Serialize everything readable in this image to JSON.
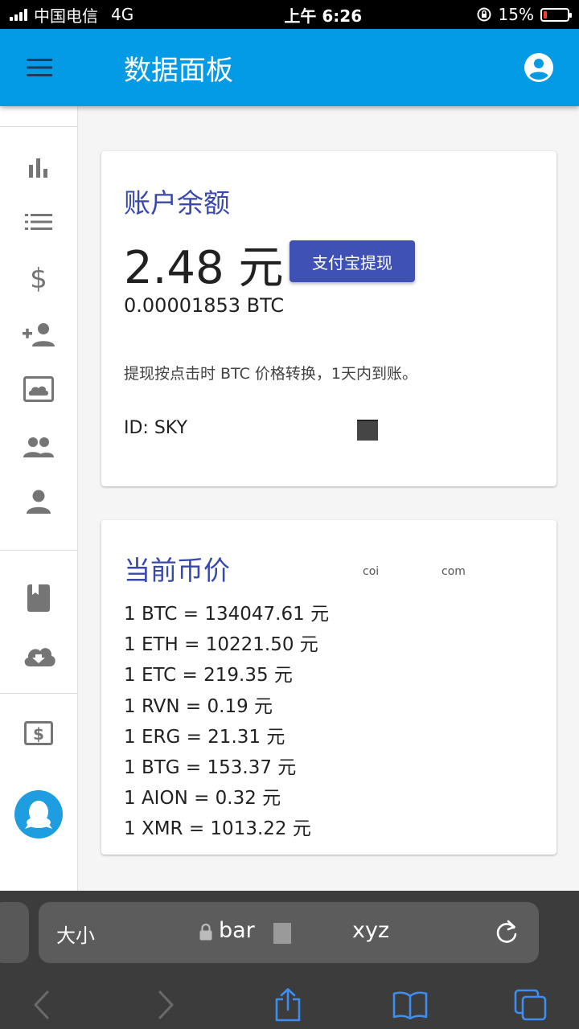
{
  "status_bar": {
    "carrier": "中国电信",
    "network": "4G",
    "time": "上午 6:26",
    "battery_percent": "15%"
  },
  "app_bar": {
    "title": "数据面板",
    "menu_icon": "menu-icon",
    "account_icon": "account-circle-icon",
    "color": "#039be5"
  },
  "drawer": {
    "items": [
      {
        "icon": "bar-chart-icon"
      },
      {
        "icon": "list-icon"
      },
      {
        "icon": "dollar-icon"
      },
      {
        "icon": "person-add-icon"
      },
      {
        "icon": "cloud-image-icon"
      },
      {
        "icon": "people-icon"
      },
      {
        "icon": "person-icon"
      },
      {
        "icon": "book-icon"
      },
      {
        "icon": "cloud-download-icon"
      },
      {
        "icon": "money-icon"
      },
      {
        "icon": "qq-icon"
      }
    ]
  },
  "balance_card": {
    "title": "账户余额",
    "amount_cny": "2.48 元",
    "withdraw_button": "支付宝提现",
    "amount_btc": "0.00001853 BTC",
    "note": "提现按点击时 BTC 价格转换，1天内到账。",
    "account_id": "ID: SKY",
    "accent": "#3f51b5"
  },
  "price_card": {
    "title": "当前币价",
    "source_fragments": [
      "coi",
      "com"
    ],
    "prices": [
      "1 BTC = 134047.61 元",
      "1 ETH = 10221.50 元",
      "1 ETC = 219.35 元",
      "1 RVN = 0.19 元",
      "1 ERG = 21.31 元",
      "1 BTG = 153.37 元",
      "1 AION = 0.32 元",
      "1 XMR = 1013.22 元"
    ]
  },
  "browser": {
    "text_size_label": "大小",
    "url_start": "bar",
    "url_end": "xyz",
    "toolbar": [
      "back-icon",
      "forward-icon",
      "share-icon",
      "bookmarks-icon",
      "tabs-icon"
    ]
  }
}
